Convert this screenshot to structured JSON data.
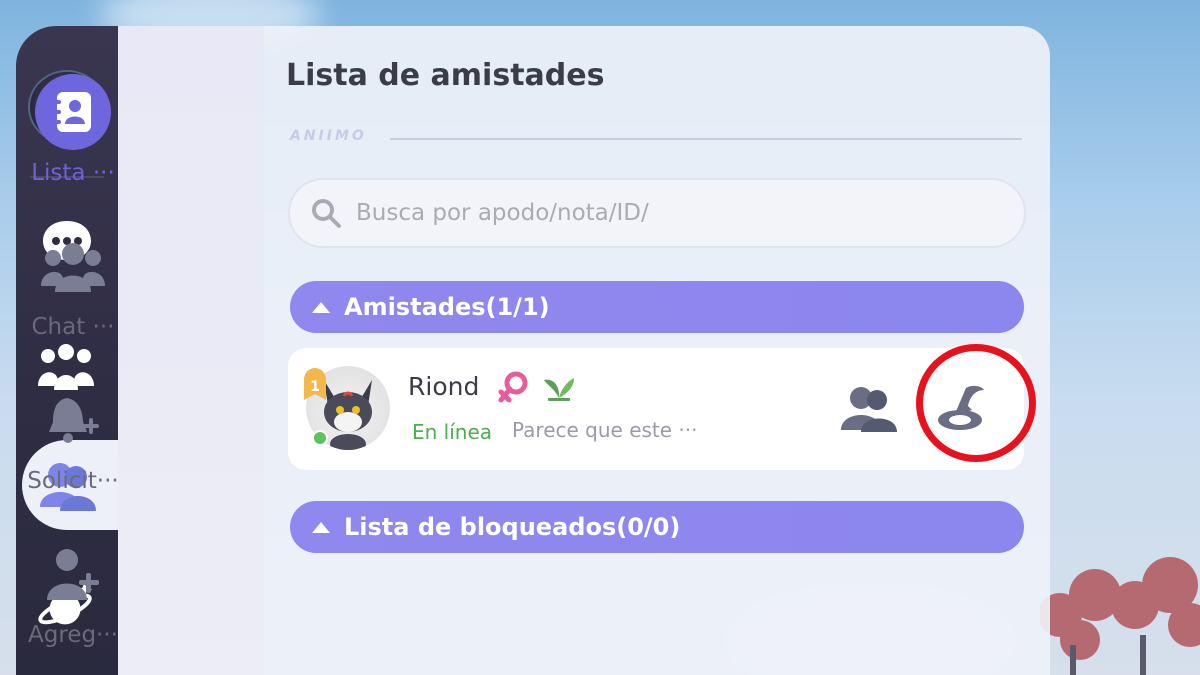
{
  "colors": {
    "accent": "#8c86ef",
    "online": "#4cae4c",
    "highlight": "#e8121c",
    "rail": "#2f2d44"
  },
  "rail": {
    "items": [
      {
        "name": "app-logo",
        "icon": "logo-icon"
      },
      {
        "name": "messages",
        "icon": "chat-bubble-icon"
      },
      {
        "name": "groups",
        "icon": "group-icon"
      },
      {
        "name": "friends",
        "icon": "friends-icon",
        "active": true
      },
      {
        "name": "explore",
        "icon": "planet-icon"
      }
    ]
  },
  "subnav": {
    "items": [
      {
        "label": "Lista ···",
        "icon": "contact-card-icon",
        "active": true
      },
      {
        "label": "Chat ···",
        "icon": "people-icon"
      },
      {
        "label": "Solicit···",
        "icon": "bell-plus-icon"
      },
      {
        "label": "Agreg···",
        "icon": "add-person-icon"
      }
    ]
  },
  "main": {
    "title": "Lista de amistades",
    "tag": "ANIIMO",
    "search": {
      "placeholder": "Busca por apodo/nota/ID/"
    },
    "groups": [
      {
        "label": "Amistades(1/1)"
      },
      {
        "label": "Lista de bloqueados(0/0)"
      }
    ],
    "friend": {
      "name": "Riond",
      "rank": "1",
      "status": "En línea",
      "note": "Parece que este ···",
      "gender_icon": "female-icon",
      "level_icon": "sprout-icon",
      "actions": [
        "group-invite-icon",
        "visit-home-icon"
      ]
    }
  }
}
